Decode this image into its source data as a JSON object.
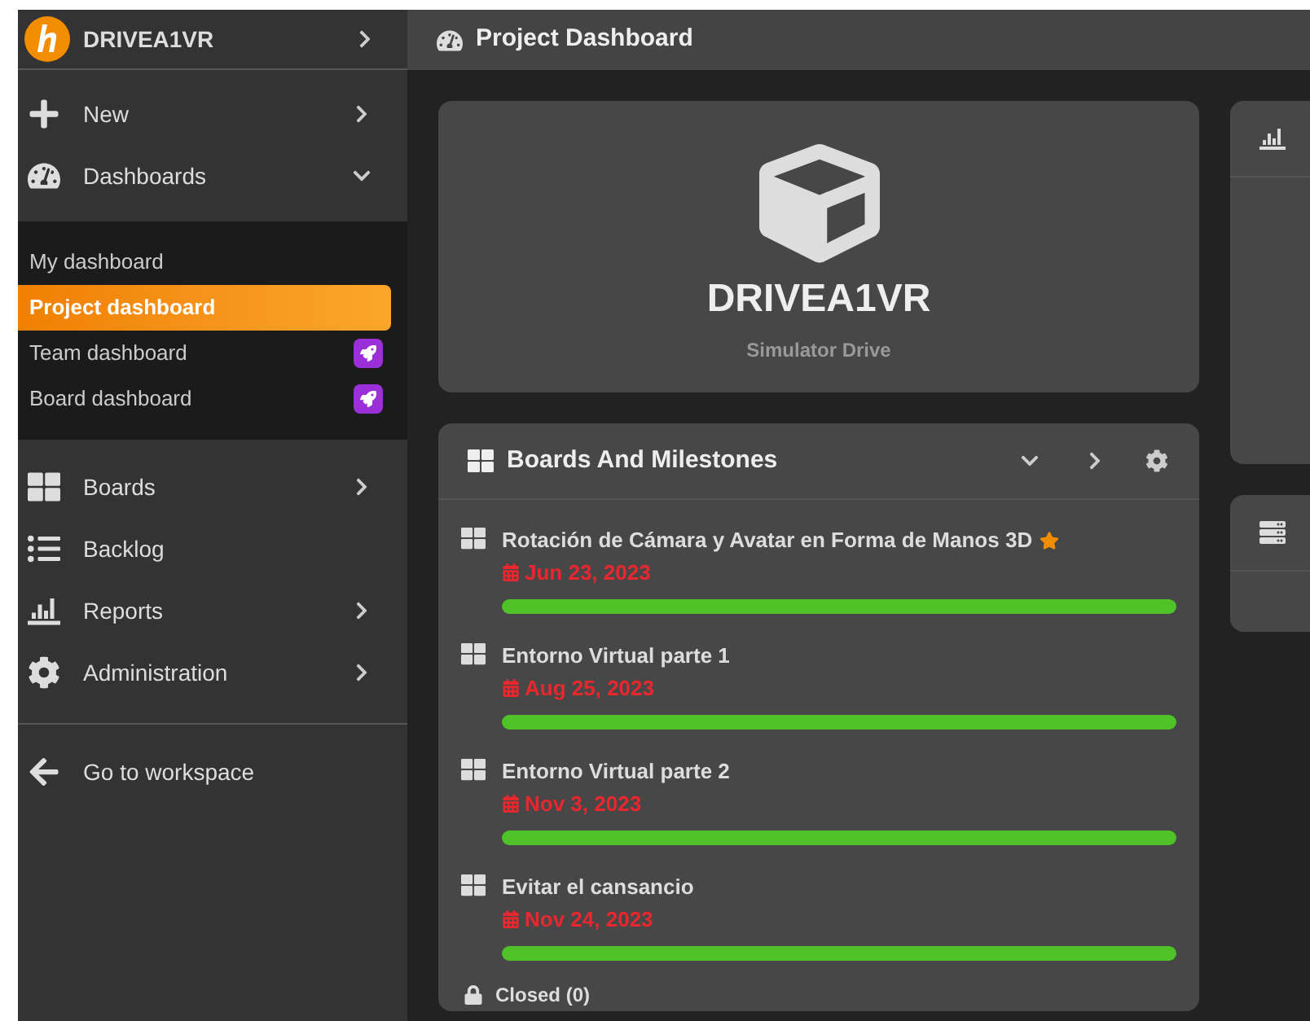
{
  "sidebar": {
    "workspace": "DRIVEA1VR",
    "menu": [
      {
        "label": "New",
        "has_submenu": true
      },
      {
        "label": "Dashboards",
        "has_submenu": true,
        "expanded": true,
        "children": [
          {
            "label": "My dashboard",
            "selected": false,
            "badge": false
          },
          {
            "label": "Project dashboard",
            "selected": true,
            "badge": false
          },
          {
            "label": "Team dashboard",
            "selected": false,
            "badge": true
          },
          {
            "label": "Board dashboard",
            "selected": false,
            "badge": true
          }
        ]
      },
      {
        "label": "Boards",
        "has_submenu": true
      },
      {
        "label": "Backlog",
        "has_submenu": false
      },
      {
        "label": "Reports",
        "has_submenu": true
      },
      {
        "label": "Administration",
        "has_submenu": true
      }
    ],
    "footer": "Go to workspace"
  },
  "page_title": "Project Dashboard",
  "project": {
    "name": "DRIVEA1VR",
    "subtitle": "Simulator Drive"
  },
  "milestones_card": {
    "title": "Boards And Milestones",
    "items": [
      {
        "name": "Rotación de Cámara y Avatar en Forma de Manos 3D",
        "starred": true,
        "date": "Jun 23, 2023",
        "level": 1
      },
      {
        "name": "Entorno Virtual parte 1",
        "starred": false,
        "date": "Aug 25, 2023",
        "level": 1
      },
      {
        "name": "Entorno Virtual parte 2",
        "starred": false,
        "date": "Nov 3, 2023",
        "level": 1
      },
      {
        "name": "Evitar el cansancio",
        "starred": false,
        "date": "Nov 24, 2023",
        "level": 1
      }
    ],
    "closed": "Closed (0)"
  }
}
